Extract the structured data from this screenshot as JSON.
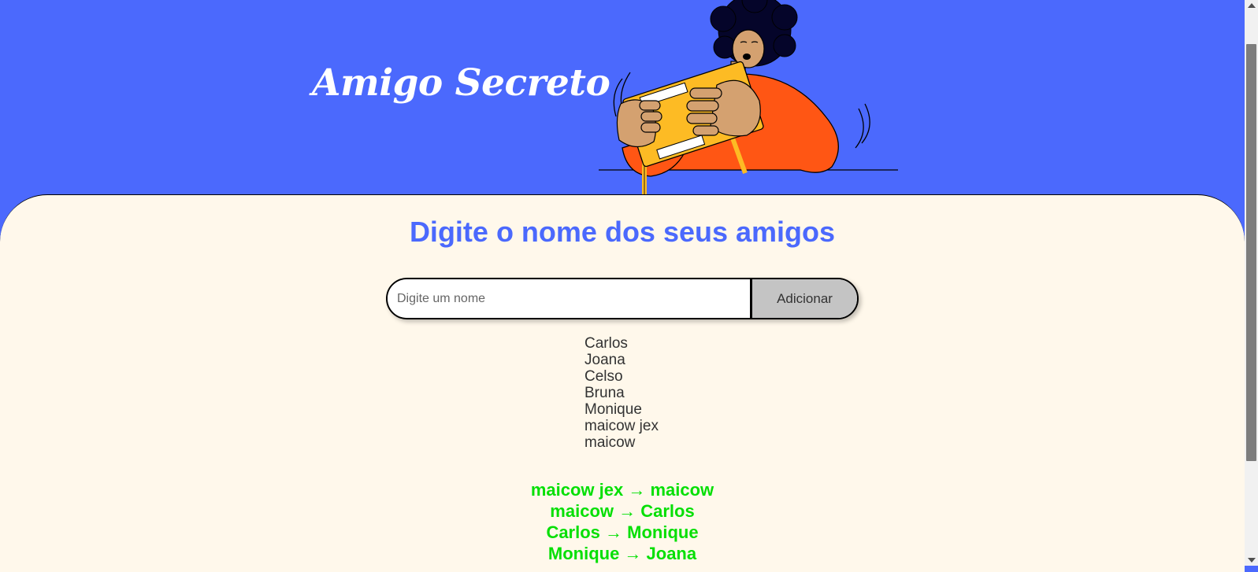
{
  "header": {
    "title": "Amigo Secreto"
  },
  "main": {
    "subtitle": "Digite o nome dos seus amigos",
    "input": {
      "placeholder": "Digite um nome",
      "value": ""
    },
    "add_button_label": "Adicionar",
    "friends": [
      "Carlos",
      "Joana",
      "Celso",
      "Bruna",
      "Monique",
      "maicow jex",
      "maicow"
    ],
    "results": [
      "maicow jex → maicow",
      "maicow → Carlos",
      "Carlos → Monique",
      "Monique → Joana"
    ]
  },
  "colors": {
    "header_bg": "#4b69fd",
    "main_bg": "#fff8eb",
    "accent": "#4b69fd",
    "result_text": "#05df05",
    "button_bg": "#c4c4c4"
  },
  "icons": {
    "illustration": "person-shaking-gift-box-icon"
  }
}
